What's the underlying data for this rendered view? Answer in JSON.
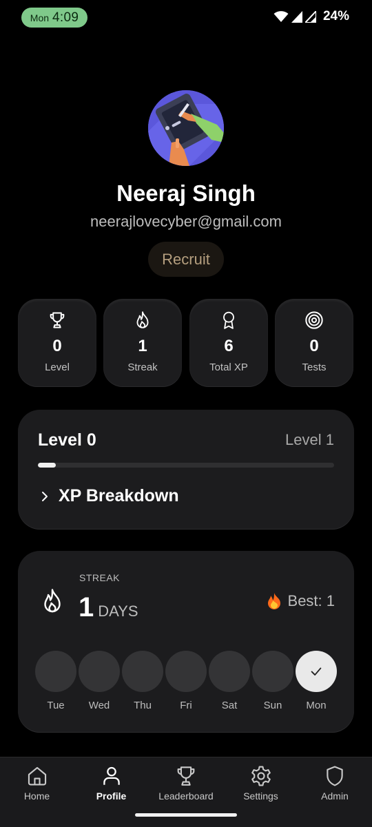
{
  "status_bar": {
    "day": "Mon",
    "time": "4:09",
    "battery": "24%",
    "icons": [
      "wifi-icon",
      "signal-icon",
      "signal-icon-2"
    ]
  },
  "profile": {
    "name": "Neeraj Singh",
    "email": "neerajlovecyber@gmail.com",
    "rank": "Recruit",
    "avatar_icon": "avatar-illustration"
  },
  "stats": [
    {
      "value": "0",
      "label": "Level",
      "icon": "trophy-icon"
    },
    {
      "value": "1",
      "label": "Streak",
      "icon": "flame-icon"
    },
    {
      "value": "6",
      "label": "Total XP",
      "icon": "award-ribbon-icon"
    },
    {
      "value": "0",
      "label": "Tests",
      "icon": "target-icon"
    }
  ],
  "level_card": {
    "current": "Level 0",
    "next": "Level 1",
    "progress_fraction": 0.06,
    "breakdown_label": "XP Breakdown"
  },
  "streak_card": {
    "caption": "STREAK",
    "count": "1",
    "unit": "DAYS",
    "best_label": "Best: 1",
    "days": [
      {
        "label": "Tue",
        "done": false
      },
      {
        "label": "Wed",
        "done": false
      },
      {
        "label": "Thu",
        "done": false
      },
      {
        "label": "Fri",
        "done": false
      },
      {
        "label": "Sat",
        "done": false
      },
      {
        "label": "Sun",
        "done": false
      },
      {
        "label": "Mon",
        "done": true
      }
    ]
  },
  "nav": {
    "active": "Profile",
    "items": [
      {
        "label": "Home",
        "icon": "home-icon"
      },
      {
        "label": "Profile",
        "icon": "user-icon"
      },
      {
        "label": "Leaderboard",
        "icon": "trophy-icon"
      },
      {
        "label": "Settings",
        "icon": "gear-icon"
      },
      {
        "label": "Admin",
        "icon": "shield-icon"
      }
    ]
  },
  "colors": {
    "background": "#000000",
    "card": "#1c1c1e",
    "time_pill": "#7fc98a",
    "rank_text": "#b59f7f",
    "best_flame": "#ff7a1a"
  }
}
